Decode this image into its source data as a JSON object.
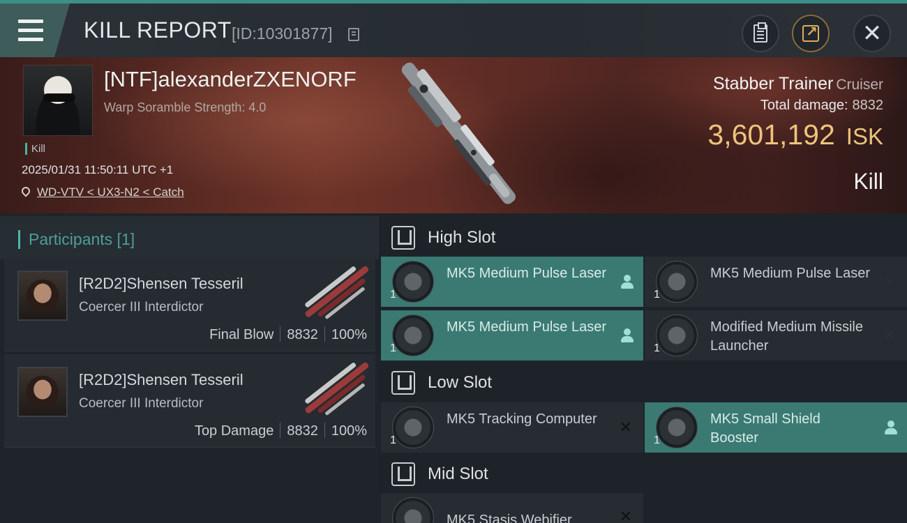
{
  "header": {
    "title": "KILL REPORT",
    "report_id": "[ID:10301877]",
    "icons": [
      "menu-icon",
      "copy-icon",
      "clipboard-icon",
      "share-icon",
      "close-icon"
    ]
  },
  "victim": {
    "name": "[NTF]alexanderZXENORF",
    "subtitle": "Warp Soramble Strength: 4.0",
    "tag": "Kill",
    "timestamp": "2025/01/31 11:50:11 UTC +1",
    "location": "WD-VTV < UX3-N2 < Catch",
    "ship_name": "Stabber Trainer",
    "ship_class": "Cruiser",
    "total_damage_label": "Total damage:",
    "total_damage": "8832",
    "isk_value": "3,601,192",
    "isk_unit": "ISK",
    "result": "Kill"
  },
  "participants": {
    "title": "Participants [1]",
    "rows": [
      {
        "name": "[R2D2]Shensen Tesseril",
        "ship": "Coercer III Interdictor",
        "role": "Final Blow",
        "damage": "8832",
        "percent": "100%"
      },
      {
        "name": "[R2D2]Shensen Tesseril",
        "ship": "Coercer III Interdictor",
        "role": "Top Damage",
        "damage": "8832",
        "percent": "100%"
      }
    ]
  },
  "fittings": {
    "high_slot": {
      "title": "High Slot",
      "items": [
        {
          "count": "1",
          "name": "MK5 Medium Pulse Laser",
          "status": "dropped"
        },
        {
          "count": "1",
          "name": "MK5 Medium Pulse Laser",
          "status": "destroyed"
        },
        {
          "count": "1",
          "name": "MK5 Medium Pulse Laser",
          "status": "dropped"
        },
        {
          "count": "1",
          "name": "Modified Medium Missile Launcher",
          "status": "destroyed"
        }
      ]
    },
    "low_slot": {
      "title": "Low Slot",
      "items": [
        {
          "count": "1",
          "name": "MK5 Tracking Computer",
          "status": "destroyed"
        },
        {
          "count": "1",
          "name": "MK5 Small Shield Booster",
          "status": "dropped"
        }
      ]
    },
    "mid_slot": {
      "title": "Mid Slot",
      "items": [
        {
          "count": "1",
          "name": "MK5 Stasis Webifier",
          "status": "destroyed"
        }
      ]
    }
  },
  "colors": {
    "accent_teal": "#3a7a73",
    "isk_gold": "#efc37c"
  }
}
